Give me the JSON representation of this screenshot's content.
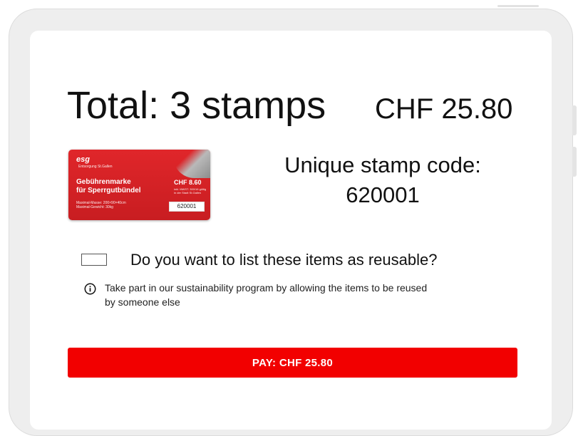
{
  "summary": {
    "total_label": "Total: 3 stamps",
    "total_price": "CHF 25.80"
  },
  "stamp_image": {
    "logo": "esg",
    "logo_sub": "Entsorgung St.Gallen",
    "name_line1": "Gebührenmarke",
    "name_line2": "für Sperrgutbündel",
    "dims_line1": "Maximal-Masse: 200×90×40cm",
    "dims_line2": "Maximal-Gewicht: 30kg",
    "price": "CHF 8.60",
    "fine_print": "inkl. MWST. 300/16 gültig in der Stadt St.Gallen",
    "code": "620001",
    "brand_color": "#d21f23"
  },
  "stamp_code": {
    "label": "Unique stamp code:",
    "value": "620001"
  },
  "reusable": {
    "question": "Do you want to list these items as reusable?",
    "checked": false,
    "info_icon": "info-circle-icon",
    "info_text": "Take part in our sustainability program by allowing the items to be reused by someone else"
  },
  "pay_button": {
    "label": "PAY: CHF 25.80",
    "color": "#f20000"
  }
}
